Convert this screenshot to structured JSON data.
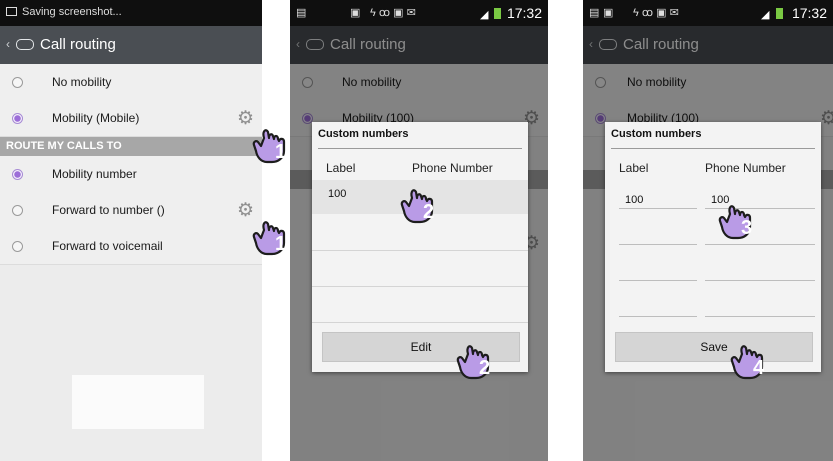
{
  "screen1": {
    "status": "Saving screenshot...",
    "title": "Call routing",
    "rows": [
      {
        "label": "No mobility",
        "selected": false,
        "gear": false
      },
      {
        "label": "Mobility (Mobile)",
        "selected": true,
        "gear": true
      }
    ],
    "section": "ROUTE MY CALLS TO",
    "route_rows": [
      {
        "label": "Mobility number",
        "selected": true,
        "gear": false
      },
      {
        "label": "Forward to number ()",
        "selected": false,
        "gear": true
      },
      {
        "label": "Forward to voicemail",
        "selected": false,
        "gear": false
      }
    ],
    "steps": [
      "1",
      "1"
    ]
  },
  "screen2": {
    "time": "17:32",
    "title": "Call routing",
    "bg_rows": [
      "No mobility",
      "Mobility (100)"
    ],
    "dialog": {
      "title": "Custom numbers",
      "col_label": "Label",
      "col_phone": "Phone Number",
      "value": "100",
      "button": "Edit"
    },
    "steps": [
      "2",
      "2"
    ]
  },
  "screen3": {
    "time": "17:32",
    "title": "Call routing",
    "bg_rows": [
      "No mobility",
      "Mobility (100)"
    ],
    "dialog": {
      "title": "Custom numbers",
      "col_label": "Label",
      "col_phone": "Phone Number",
      "label_value": "100",
      "phone_value": "100",
      "button": "Save"
    },
    "steps": [
      "3",
      "4"
    ]
  },
  "colors": {
    "accent": "#9c6dd8",
    "titlebar": "#4a4e53",
    "hand": "#b99be6"
  }
}
